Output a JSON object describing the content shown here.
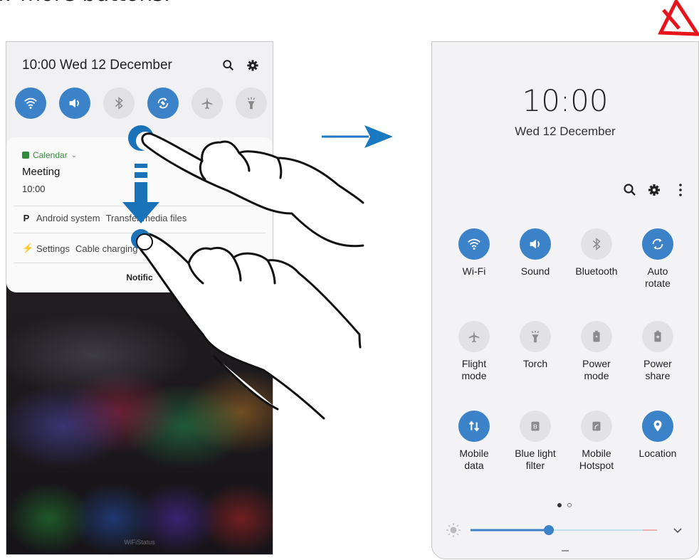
{
  "caption": "w more buttons.",
  "left_panel": {
    "time_date": "10:00  Wed 12 December",
    "quick_toggles": [
      {
        "icon": "wifi-icon",
        "on": true
      },
      {
        "icon": "sound-icon",
        "on": true
      },
      {
        "icon": "bluetooth-icon",
        "on": false
      },
      {
        "icon": "auto-rotate-icon",
        "on": true
      },
      {
        "icon": "airplane-icon",
        "on": false
      },
      {
        "icon": "torch-icon",
        "on": false
      }
    ],
    "notification": {
      "app": "Calendar",
      "title": "Meeting",
      "time": "10:00",
      "android_system_app": "Android system",
      "android_system_text": "Transfer media files",
      "settings_app": "Settings",
      "settings_text": "Cable charging",
      "footer": "Notific"
    },
    "background_label": "WiFiStatus"
  },
  "right_panel": {
    "time": "10:00",
    "date": "Wed 12 December",
    "tiles": [
      {
        "label": "Wi-Fi",
        "icon": "wifi-icon",
        "on": true
      },
      {
        "label": "Sound",
        "icon": "sound-icon",
        "on": true
      },
      {
        "label": "Bluetooth",
        "icon": "bluetooth-icon",
        "on": false
      },
      {
        "label": "Auto\nrotate",
        "icon": "auto-rotate-icon",
        "on": true
      },
      {
        "label": "Flight\nmode",
        "icon": "airplane-icon",
        "on": false
      },
      {
        "label": "Torch",
        "icon": "torch-icon",
        "on": false
      },
      {
        "label": "Power\nmode",
        "icon": "power-mode-icon",
        "on": false
      },
      {
        "label": "Power\nshare",
        "icon": "power-share-icon",
        "on": false
      },
      {
        "label": "Mobile\ndata",
        "icon": "mobile-data-icon",
        "on": true
      },
      {
        "label": "Blue light\nfilter",
        "icon": "blue-light-icon",
        "on": false
      },
      {
        "label": "Mobile\nHotspot",
        "icon": "hotspot-icon",
        "on": false
      },
      {
        "label": "Location",
        "icon": "location-icon",
        "on": true
      }
    ],
    "page_indicator": {
      "current": 1,
      "total": 2
    },
    "brightness_level": 0.42
  },
  "colors": {
    "accent": "#3b82c8",
    "tile_off": "#e2e2e6",
    "arrow": "#1a78c2"
  }
}
